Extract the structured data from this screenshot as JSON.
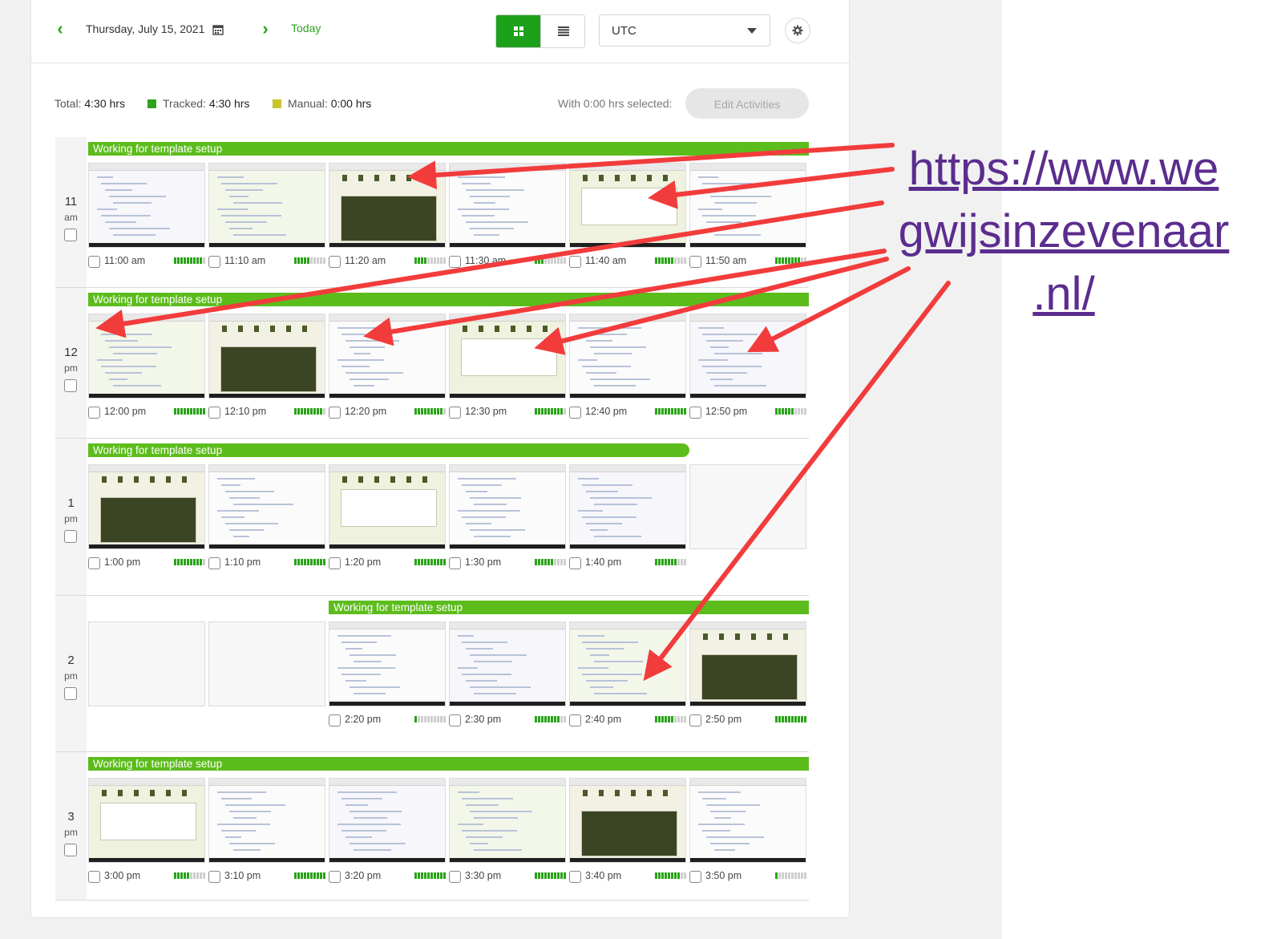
{
  "header": {
    "date": "Thursday, July 15, 2021",
    "today_label": "Today",
    "timezone": "UTC",
    "accent_color": "#2da31e"
  },
  "summary": {
    "total_label": "Total:",
    "total_value": "4:30 hrs",
    "tracked_label": "Tracked:",
    "tracked_value": "4:30 hrs",
    "manual_label": "Manual:",
    "manual_value": "0:00 hrs",
    "tracked_color": "#2da31e",
    "manual_color": "#c9c42a",
    "selected_text": "With 0:00 hrs selected:",
    "edit_button": "Edit Activities"
  },
  "hours": [
    {
      "hour": "11",
      "ampm": "am",
      "project": "Working for template setup",
      "slots": [
        {
          "time": "11:00 am",
          "activity": 0.9,
          "empty": false
        },
        {
          "time": "11:10 am",
          "activity": 0.5,
          "empty": false
        },
        {
          "time": "11:20 am",
          "activity": 0.4,
          "empty": false
        },
        {
          "time": "11:30 am",
          "activity": 0.3,
          "empty": false
        },
        {
          "time": "11:40 am",
          "activity": 0.6,
          "empty": false
        },
        {
          "time": "11:50 am",
          "activity": 0.8,
          "empty": false
        }
      ]
    },
    {
      "hour": "12",
      "ampm": "pm",
      "project": "Working for template setup",
      "slots": [
        {
          "time": "12:00 pm",
          "activity": 1.0,
          "empty": false
        },
        {
          "time": "12:10 pm",
          "activity": 0.9,
          "empty": false
        },
        {
          "time": "12:20 pm",
          "activity": 0.9,
          "empty": false
        },
        {
          "time": "12:30 pm",
          "activity": 0.9,
          "empty": false
        },
        {
          "time": "12:40 pm",
          "activity": 1.0,
          "empty": false
        },
        {
          "time": "12:50 pm",
          "activity": 0.6,
          "empty": false
        }
      ]
    },
    {
      "hour": "1",
      "ampm": "pm",
      "project": "Working for template setup",
      "slots": [
        {
          "time": "1:00 pm",
          "activity": 0.9,
          "empty": false
        },
        {
          "time": "1:10 pm",
          "activity": 1.0,
          "empty": false
        },
        {
          "time": "1:20 pm",
          "activity": 1.0,
          "empty": false
        },
        {
          "time": "1:30 pm",
          "activity": 0.6,
          "empty": false
        },
        {
          "time": "1:40 pm",
          "activity": 0.7,
          "empty": false
        },
        {
          "time": "",
          "activity": 0,
          "empty": true
        }
      ]
    },
    {
      "hour": "2",
      "ampm": "pm",
      "project": "Working for template setup",
      "slots": [
        {
          "time": "",
          "activity": 0,
          "empty": true
        },
        {
          "time": "",
          "activity": 0,
          "empty": true
        },
        {
          "time": "2:20 pm",
          "activity": 0.1,
          "empty": false
        },
        {
          "time": "2:30 pm",
          "activity": 0.8,
          "empty": false
        },
        {
          "time": "2:40 pm",
          "activity": 0.6,
          "empty": false
        },
        {
          "time": "2:50 pm",
          "activity": 1.0,
          "empty": false
        }
      ]
    },
    {
      "hour": "3",
      "ampm": "pm",
      "project": "Working for template setup",
      "slots": [
        {
          "time": "3:00 pm",
          "activity": 0.5,
          "empty": false
        },
        {
          "time": "3:10 pm",
          "activity": 1.0,
          "empty": false
        },
        {
          "time": "3:20 pm",
          "activity": 1.0,
          "empty": false
        },
        {
          "time": "3:30 pm",
          "activity": 1.0,
          "empty": false
        },
        {
          "time": "3:40 pm",
          "activity": 0.8,
          "empty": false
        },
        {
          "time": "3:50 pm",
          "activity": 0.1,
          "empty": false
        }
      ]
    }
  ],
  "annotation": {
    "url_line1": "https://www.we",
    "url_line2": "gwijsinzevenaar",
    "url_line3": ".nl/",
    "url_color": "#5b2d8e",
    "arrow_color": "#f23c3c"
  }
}
